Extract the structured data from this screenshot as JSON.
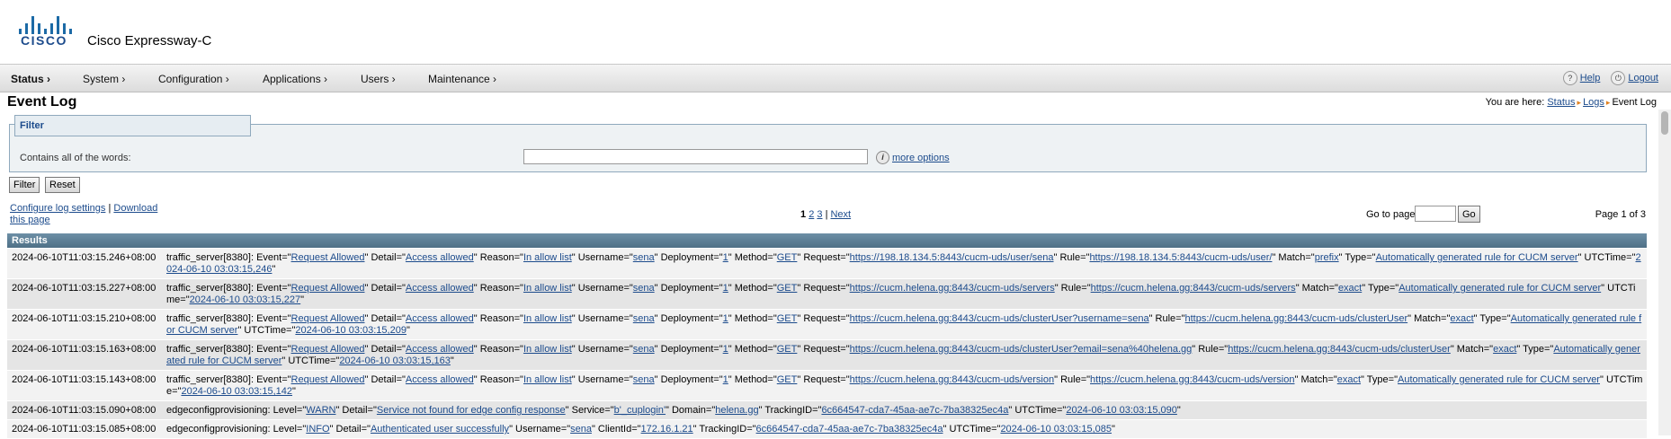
{
  "brand": {
    "logo_text": "CISCO",
    "product": "Cisco Expressway-C",
    "color": "#1c6aa6"
  },
  "nav": {
    "items": [
      "Status",
      "System",
      "Configuration",
      "Applications",
      "Users",
      "Maintenance"
    ],
    "help": "Help",
    "logout": "Logout"
  },
  "page": {
    "title": "Event Log"
  },
  "breadcrumb": {
    "prefix": "You are here:",
    "items": [
      "Status",
      "Logs",
      "Event Log"
    ]
  },
  "filter": {
    "legend": "Filter",
    "label": "Contains all of the words:",
    "value": "",
    "more_options": "more options",
    "filter_button": "Filter",
    "reset_button": "Reset"
  },
  "links": {
    "configure": "Configure log settings",
    "separator": "|",
    "download": "Download this page"
  },
  "pager": {
    "current": "1",
    "pages": [
      "2",
      "3"
    ],
    "separator": "|",
    "next": "Next",
    "goto_label": "Go to page",
    "goto_value": "",
    "go_button": "Go",
    "page_of": "Page 1 of 3"
  },
  "results": {
    "heading": "Results",
    "rows": [
      {
        "ts": "2024-06-10T11:03:15.246+08:00",
        "parts": [
          [
            "t",
            "traffic_server[8380]: Event=\""
          ],
          [
            "l",
            "Request Allowed"
          ],
          [
            "t",
            "\" Detail=\""
          ],
          [
            "l",
            "Access allowed"
          ],
          [
            "t",
            "\" Reason=\""
          ],
          [
            "l",
            "In allow list"
          ],
          [
            "t",
            "\" Username=\""
          ],
          [
            "l",
            "sena"
          ],
          [
            "t",
            "\" Deployment=\""
          ],
          [
            "l",
            "1"
          ],
          [
            "t",
            "\" Method=\""
          ],
          [
            "l",
            "GET"
          ],
          [
            "t",
            "\" Request=\""
          ],
          [
            "l",
            "https://198.18.134.5:8443/cucm-uds/user/sena"
          ],
          [
            "t",
            "\" Rule=\""
          ],
          [
            "l",
            "https://198.18.134.5:8443/cucm-uds/user/"
          ],
          [
            "t",
            "\" Match=\""
          ],
          [
            "l",
            "prefix"
          ],
          [
            "t",
            "\" Type=\""
          ],
          [
            "l",
            "Automatically generated rule for CUCM server"
          ],
          [
            "t",
            "\" UTCTime=\""
          ],
          [
            "l",
            "2024-06-10 03:03:15,246"
          ],
          [
            "t",
            "\""
          ]
        ]
      },
      {
        "ts": "2024-06-10T11:03:15.227+08:00",
        "parts": [
          [
            "t",
            "traffic_server[8380]: Event=\""
          ],
          [
            "l",
            "Request Allowed"
          ],
          [
            "t",
            "\" Detail=\""
          ],
          [
            "l",
            "Access allowed"
          ],
          [
            "t",
            "\" Reason=\""
          ],
          [
            "l",
            "In allow list"
          ],
          [
            "t",
            "\" Username=\""
          ],
          [
            "l",
            "sena"
          ],
          [
            "t",
            "\" Deployment=\""
          ],
          [
            "l",
            "1"
          ],
          [
            "t",
            "\" Method=\""
          ],
          [
            "l",
            "GET"
          ],
          [
            "t",
            "\" Request=\""
          ],
          [
            "l",
            "https://cucm.helena.gg:8443/cucm-uds/servers"
          ],
          [
            "t",
            "\" Rule=\""
          ],
          [
            "l",
            "https://cucm.helena.gg:8443/cucm-uds/servers"
          ],
          [
            "t",
            "\" Match=\""
          ],
          [
            "l",
            "exact"
          ],
          [
            "t",
            "\" Type=\""
          ],
          [
            "l",
            "Automatically generated rule for CUCM server"
          ],
          [
            "t",
            "\" UTCTime=\""
          ],
          [
            "l",
            "2024-06-10 03:03:15,227"
          ],
          [
            "t",
            "\""
          ]
        ]
      },
      {
        "ts": "2024-06-10T11:03:15.210+08:00",
        "parts": [
          [
            "t",
            "traffic_server[8380]: Event=\""
          ],
          [
            "l",
            "Request Allowed"
          ],
          [
            "t",
            "\" Detail=\""
          ],
          [
            "l",
            "Access allowed"
          ],
          [
            "t",
            "\" Reason=\""
          ],
          [
            "l",
            "In allow list"
          ],
          [
            "t",
            "\" Username=\""
          ],
          [
            "l",
            "sena"
          ],
          [
            "t",
            "\" Deployment=\""
          ],
          [
            "l",
            "1"
          ],
          [
            "t",
            "\" Method=\""
          ],
          [
            "l",
            "GET"
          ],
          [
            "t",
            "\" Request=\""
          ],
          [
            "l",
            "https://cucm.helena.gg:8443/cucm-uds/clusterUser?username=sena"
          ],
          [
            "t",
            "\" Rule=\""
          ],
          [
            "l",
            "https://cucm.helena.gg:8443/cucm-uds/clusterUser"
          ],
          [
            "t",
            "\" Match=\""
          ],
          [
            "l",
            "exact"
          ],
          [
            "t",
            "\" Type=\""
          ],
          [
            "l",
            "Automatically generated rule for CUCM server"
          ],
          [
            "t",
            "\" UTCTime=\""
          ],
          [
            "l",
            "2024-06-10 03:03:15,209"
          ],
          [
            "t",
            "\""
          ]
        ]
      },
      {
        "ts": "2024-06-10T11:03:15.163+08:00",
        "parts": [
          [
            "t",
            "traffic_server[8380]: Event=\""
          ],
          [
            "l",
            "Request Allowed"
          ],
          [
            "t",
            "\" Detail=\""
          ],
          [
            "l",
            "Access allowed"
          ],
          [
            "t",
            "\" Reason=\""
          ],
          [
            "l",
            "In allow list"
          ],
          [
            "t",
            "\" Username=\""
          ],
          [
            "l",
            "sena"
          ],
          [
            "t",
            "\" Deployment=\""
          ],
          [
            "l",
            "1"
          ],
          [
            "t",
            "\" Method=\""
          ],
          [
            "l",
            "GET"
          ],
          [
            "t",
            "\" Request=\""
          ],
          [
            "l",
            "https://cucm.helena.gg:8443/cucm-uds/clusterUser?email=sena%40helena.gg"
          ],
          [
            "t",
            "\" Rule=\""
          ],
          [
            "l",
            "https://cucm.helena.gg:8443/cucm-uds/clusterUser"
          ],
          [
            "t",
            "\" Match=\""
          ],
          [
            "l",
            "exact"
          ],
          [
            "t",
            "\" Type=\""
          ],
          [
            "l",
            "Automatically generated rule for CUCM server"
          ],
          [
            "t",
            "\" UTCTime=\""
          ],
          [
            "l",
            "2024-06-10 03:03:15,163"
          ],
          [
            "t",
            "\""
          ]
        ]
      },
      {
        "ts": "2024-06-10T11:03:15.143+08:00",
        "parts": [
          [
            "t",
            "traffic_server[8380]: Event=\""
          ],
          [
            "l",
            "Request Allowed"
          ],
          [
            "t",
            "\" Detail=\""
          ],
          [
            "l",
            "Access allowed"
          ],
          [
            "t",
            "\" Reason=\""
          ],
          [
            "l",
            "In allow list"
          ],
          [
            "t",
            "\" Username=\""
          ],
          [
            "l",
            "sena"
          ],
          [
            "t",
            "\" Deployment=\""
          ],
          [
            "l",
            "1"
          ],
          [
            "t",
            "\" Method=\""
          ],
          [
            "l",
            "GET"
          ],
          [
            "t",
            "\" Request=\""
          ],
          [
            "l",
            "https://cucm.helena.gg:8443/cucm-uds/version"
          ],
          [
            "t",
            "\" Rule=\""
          ],
          [
            "l",
            "https://cucm.helena.gg:8443/cucm-uds/version"
          ],
          [
            "t",
            "\" Match=\""
          ],
          [
            "l",
            "exact"
          ],
          [
            "t",
            "\" Type=\""
          ],
          [
            "l",
            "Automatically generated rule for CUCM server"
          ],
          [
            "t",
            "\" UTCTime=\""
          ],
          [
            "l",
            "2024-06-10 03:03:15,142"
          ],
          [
            "t",
            "\""
          ]
        ]
      },
      {
        "ts": "2024-06-10T11:03:15.090+08:00",
        "parts": [
          [
            "t",
            "edgeconfigprovisioning: Level=\""
          ],
          [
            "l",
            "WARN"
          ],
          [
            "t",
            "\" Detail=\""
          ],
          [
            "l",
            "Service not found for edge config response"
          ],
          [
            "t",
            "\" Service=\""
          ],
          [
            "l",
            "b'_cuplogin'"
          ],
          [
            "t",
            "\" Domain=\""
          ],
          [
            "l",
            "helena.gg"
          ],
          [
            "t",
            "\" TrackingID=\""
          ],
          [
            "l",
            "6c664547-cda7-45aa-ae7c-7ba38325ec4a"
          ],
          [
            "t",
            "\" UTCTime=\""
          ],
          [
            "l",
            "2024-06-10 03:03:15,090"
          ],
          [
            "t",
            "\""
          ]
        ]
      },
      {
        "ts": "2024-06-10T11:03:15.085+08:00",
        "parts": [
          [
            "t",
            "edgeconfigprovisioning: Level=\""
          ],
          [
            "l",
            "INFO"
          ],
          [
            "t",
            "\" Detail=\""
          ],
          [
            "l",
            "Authenticated user successfully"
          ],
          [
            "t",
            "\" Username=\""
          ],
          [
            "l",
            "sena"
          ],
          [
            "t",
            "\" ClientId=\""
          ],
          [
            "l",
            "172.16.1.21"
          ],
          [
            "t",
            "\" TrackingID=\""
          ],
          [
            "l",
            "6c664547-cda7-45aa-ae7c-7ba38325ec4a"
          ],
          [
            "t",
            "\" UTCTime=\""
          ],
          [
            "l",
            "2024-06-10 03:03:15,085"
          ],
          [
            "t",
            "\""
          ]
        ]
      }
    ]
  }
}
